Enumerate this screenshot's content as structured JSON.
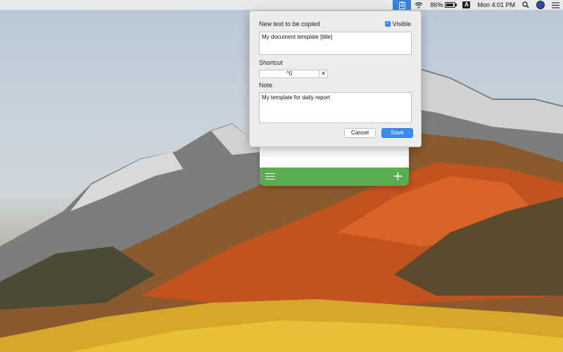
{
  "menubar": {
    "battery_percent_label": "86%",
    "battery_level": 0.86,
    "input_source": "A",
    "clock": "Mon 4:01 PM"
  },
  "popover": {
    "text_label": "New text to be copied",
    "visible_label": "Visible",
    "visible_checked": true,
    "text_value": "My document template [title]",
    "shortcut_label": "Shortcut",
    "shortcut_value": "^0",
    "clear_symbol": "✕",
    "note_label": "Note",
    "note_value": "My template for daily report",
    "cancel_label": "Cancel",
    "save_label": "Save"
  },
  "icons": {
    "app": "clipboard-icon",
    "wifi": "wifi-icon",
    "battery": "battery-icon",
    "search": "search-icon",
    "user": "user-avatar-icon",
    "control_center": "list-icon",
    "menu": "hamburger-icon",
    "add": "plus-icon"
  },
  "colors": {
    "accent": "#3b8cf7",
    "toolbar_green": "#5bad52"
  }
}
